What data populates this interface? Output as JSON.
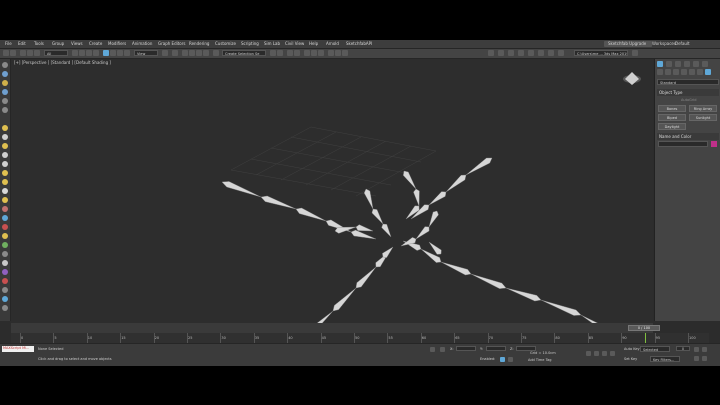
{
  "menu": [
    "File",
    "Edit",
    "Tools",
    "Group",
    "Views",
    "Create",
    "Modifiers",
    "Animation",
    "Graph Editors",
    "Rendering",
    "Customize",
    "Scripting",
    "Sim Lab",
    "Civil View",
    "Help",
    "Arnold",
    "SketchfabAPI"
  ],
  "sign_in": "Sketchfab Upgrade",
  "workspaces_label": "Workspaces:",
  "workspaces_value": "Default",
  "toolbar": {
    "filter": "All",
    "view": "View",
    "selection_set": "Create Selection Se",
    "project": "C:\\Users\\me ... 3ds Max 2019"
  },
  "viewport_label": "[+] [Perspective ] [Standard ] [Default Shading ]",
  "command_panel": {
    "category": "Standard",
    "object_type": "Object Type",
    "autogrid": "AutoGrid",
    "buttons": [
      "Bones",
      "Ring Array",
      "Biped",
      "Sunlight",
      "Daylight"
    ],
    "name_and_color": "Name and Color"
  },
  "time_slider": "0 / 100",
  "timeline_ticks": [
    "0",
    "5",
    "10",
    "15",
    "20",
    "25",
    "30",
    "35",
    "40",
    "45",
    "50",
    "55",
    "60",
    "65",
    "70",
    "75",
    "80",
    "85",
    "90",
    "95",
    "100"
  ],
  "status": {
    "maxscript": "MAXScript Mi...",
    "selected": "None Selected",
    "prompt": "Click and drag to select and move objects",
    "x_label": "X:",
    "y_label": "Y:",
    "z_label": "Z:",
    "grid": "Grid = 10.0cm",
    "add_time_tag": "Add Time Tag",
    "enabled": "Enabled:",
    "auto_key": "Auto Key",
    "selected_dd": "Selected",
    "set_key": "Set Key",
    "key_filters": "Key Filters...",
    "frame": "0"
  },
  "colors": {
    "viewport_bg": "#2d2d2d",
    "accent": "#5fa8d8",
    "bone": "#d6d6d6",
    "timeline_marker": "#7fbf3f"
  }
}
